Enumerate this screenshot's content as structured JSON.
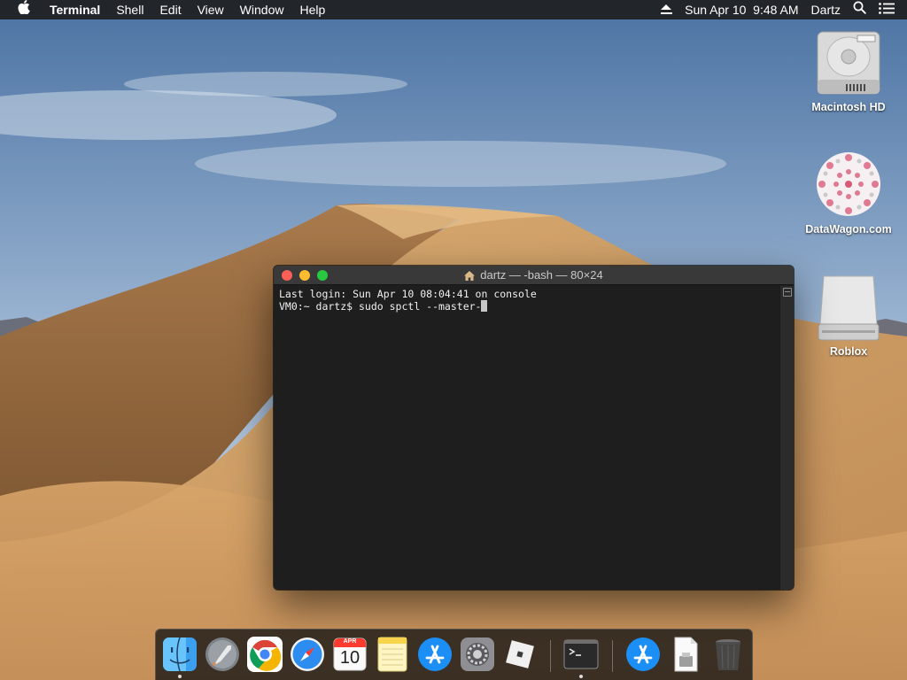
{
  "menubar": {
    "apple": "",
    "app_name": "Terminal",
    "items": [
      "Shell",
      "Edit",
      "View",
      "Window",
      "Help"
    ],
    "clock": "Sun Apr 10  9:48 AM",
    "user": "Dartz"
  },
  "desktop": {
    "icons": [
      {
        "label": "Macintosh HD",
        "icon": "hard-drive-icon"
      },
      {
        "label": "DataWagon.com",
        "icon": "flower-pattern-icon"
      },
      {
        "label": "Roblox",
        "icon": "external-drive-icon"
      }
    ]
  },
  "terminal": {
    "title": "dartz — -bash — 80×24",
    "lines": [
      "Last login: Sun Apr 10 08:04:41 on console",
      "VM0:~ dartz$ sudo spctl --master-"
    ]
  },
  "dock": {
    "items": [
      {
        "name": "Finder",
        "icon": "finder-icon",
        "running": true
      },
      {
        "name": "Launchpad",
        "icon": "launchpad-icon",
        "running": false
      },
      {
        "name": "Google Chrome",
        "icon": "chrome-icon",
        "running": false
      },
      {
        "name": "Safari",
        "icon": "safari-icon",
        "running": false
      },
      {
        "name": "Calendar",
        "icon": "calendar-icon",
        "running": false,
        "month": "APR",
        "day": "10"
      },
      {
        "name": "Notes",
        "icon": "notes-icon",
        "running": false
      },
      {
        "name": "App Store",
        "icon": "app-store-icon",
        "running": false
      },
      {
        "name": "System Preferences",
        "icon": "system-preferences-icon",
        "running": false
      },
      {
        "name": "Roblox",
        "icon": "roblox-icon",
        "running": false
      },
      {
        "name": "Terminal",
        "icon": "terminal-icon",
        "running": true
      },
      {
        "name": "App Store Downloads",
        "icon": "app-store-folder-icon",
        "running": false
      },
      {
        "name": "Document",
        "icon": "document-icon",
        "running": false
      },
      {
        "name": "Trash",
        "icon": "trash-icon",
        "running": false
      }
    ]
  },
  "colors": {
    "menubar_bg": "#1e1e1e",
    "terminal_bg": "#1e1e1e",
    "close": "#fc5f57",
    "minimize": "#fdbc2e",
    "maximize": "#28c840"
  }
}
